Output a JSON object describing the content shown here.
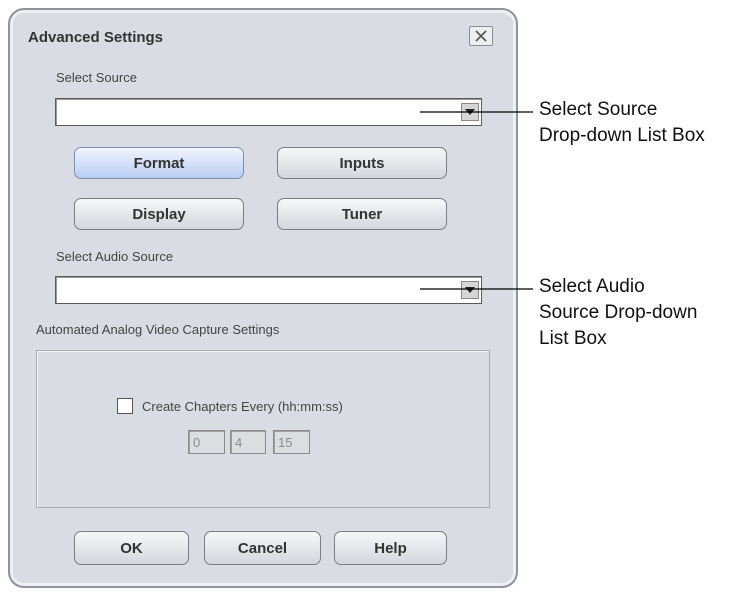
{
  "dialog": {
    "title": "Advanced Settings",
    "close_icon": "close-icon",
    "select_source_label": "Select Source",
    "select_source_value": "",
    "buttons": {
      "format": "Format",
      "inputs": "Inputs",
      "display": "Display",
      "tuner": "Tuner"
    },
    "active_button": "Format",
    "select_audio_label": "Select Audio Source",
    "select_audio_value": "",
    "capture_group_label": "Automated Analog Video Capture Settings",
    "chapters_label": "Create Chapters Every (hh:mm:ss)",
    "chapters_checked": false,
    "time": {
      "hh": "0",
      "mm": "4",
      "ss": "15"
    },
    "footer": {
      "ok": "OK",
      "cancel": "Cancel",
      "help": "Help"
    }
  },
  "callouts": {
    "source": [
      "Select Source",
      "Drop-down List Box"
    ],
    "audio": [
      "Select Audio",
      "Source Drop-down",
      "List Box"
    ]
  },
  "colors": {
    "active_button": "#b9cdf2",
    "dialog_bg": "#d9dce2"
  }
}
